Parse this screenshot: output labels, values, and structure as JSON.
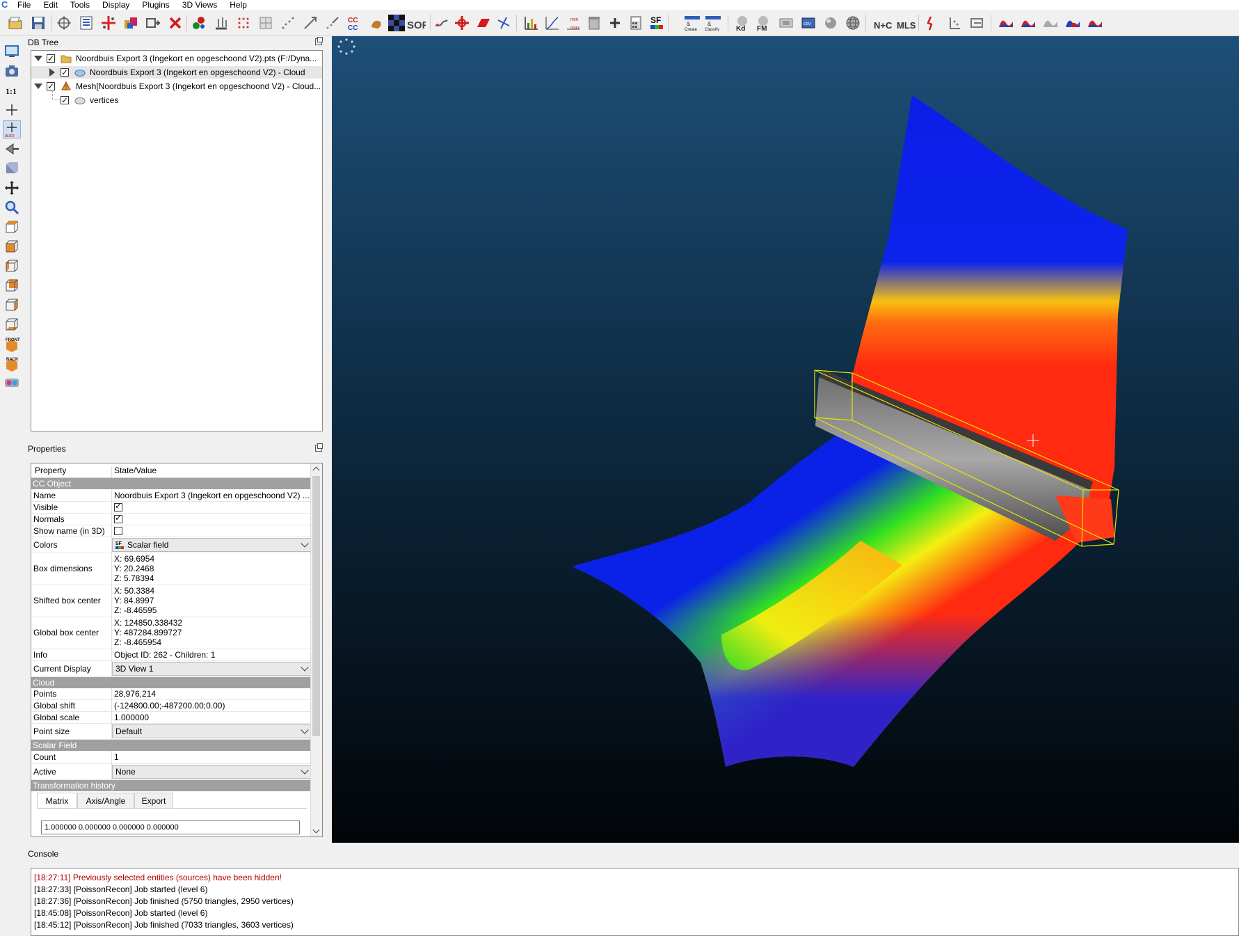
{
  "app": {
    "icon": "cloudcompare-logo-icon"
  },
  "menu": [
    "File",
    "Edit",
    "Tools",
    "Display",
    "Plugins",
    "3D Views",
    "Help"
  ],
  "toolbar": {
    "icons": [
      "open-icon",
      "save-icon",
      "global-shift-icon",
      "list-icon",
      "add-point-icon",
      "merge-icon",
      "clone-icon",
      "delete-icon",
      "sample-icon",
      "normals-icon",
      "subsample-icon",
      "octree-icon",
      "sf-gradient-icon",
      "register-icon",
      "align-icon",
      "cloud-cloud-dist-icon",
      "cloud-mesh-dist-icon",
      "checkerboard-icon",
      "sor-icon",
      "segment-icon",
      "translate-rotate-icon",
      "cross-section-icon",
      "point-pick-icon",
      "histogram-icon",
      "sf-gradient-plot-icon",
      "sf-minmax-icon",
      "filter-icon",
      "add-icon",
      "calculator-icon",
      "sf-icon",
      "canupo-create-icon",
      "canupo-classify-icon",
      "kd-icon",
      "fm-icon",
      "plane-fit-icon",
      "quadric-icon",
      "sphere-icon",
      "globe-icon",
      "n-c-icon",
      "mls-icon",
      "sf-tool-icon",
      "rasterize-icon",
      "clean-icon",
      "pcv-1-icon",
      "pcv-2-icon",
      "pcv-3-icon",
      "pcv-4-icon",
      "pcv-5-icon"
    ],
    "labels": {
      "sor": "SOR",
      "sf": "SF",
      "kd": "Kd",
      "fm": "FM",
      "nc": "N+C",
      "mls": "MLS",
      "cc": "CC\nCC",
      "canupo1": "CANUPO Create",
      "canupo2": "CANUPO Classify"
    }
  },
  "left_tools": [
    "display-icon",
    "camera-icon",
    "one-to-one-icon",
    "crosshair-icon",
    "auto-pick-icon",
    "perspective-icon",
    "cube-view-icon",
    "move-icon",
    "zoom-icon",
    "top-view-icon",
    "front-view-icon",
    "left-view-icon",
    "back-view-icon",
    "right-view-icon",
    "bottom-view-icon",
    "front-iso-icon",
    "back-iso-icon",
    "stereo-icon"
  ],
  "left_labels": {
    "one_to_one": "1:1",
    "auto": "auto",
    "front": "FRONT",
    "back": "BACK"
  },
  "db_tree": {
    "title": "DB Tree",
    "items": [
      {
        "label": "Noordbuis Export 3 (Ingekort en opgeschoond V2).pts (F:/Dyna...",
        "icon": "folder-icon",
        "checked": true
      },
      {
        "label": "Noordbuis Export 3 (Ingekort en opgeschoond V2) - Cloud",
        "icon": "cloud-icon",
        "checked": true
      },
      {
        "label": "Mesh[Noordbuis Export 3 (Ingekort en opgeschoond V2) - Cloud...",
        "icon": "mesh-icon",
        "checked": true
      },
      {
        "label": "vertices",
        "icon": "cloud-icon",
        "checked": true
      }
    ]
  },
  "properties": {
    "title": "Properties",
    "header": {
      "property": "Property",
      "value": "State/Value"
    },
    "sections": {
      "cc_object": "CC Object",
      "cloud": "Cloud",
      "scalar_field": "Scalar Field",
      "transformation_history": "Transformation history"
    },
    "rows": {
      "name": {
        "key": "Name",
        "value": "Noordbuis Export 3 (Ingekort en opgeschoond V2) ..."
      },
      "visible": {
        "key": "Visible",
        "checked": true
      },
      "normals": {
        "key": "Normals",
        "checked": true
      },
      "show_name": {
        "key": "Show name (in 3D)",
        "checked": false
      },
      "colors": {
        "key": "Colors",
        "value": "Scalar field",
        "icon": "sf-icon"
      },
      "box_dimensions": {
        "key": "Box dimensions",
        "x": "X: 69.6954",
        "y": "Y: 20.2468",
        "z": "Z: 5.78394"
      },
      "shifted_box_center": {
        "key": "Shifted box center",
        "x": "X: 50.3384",
        "y": "Y: 84.8997",
        "z": "Z: -8.46595"
      },
      "global_box_center": {
        "key": "Global box center",
        "x": "X: 124850.338432",
        "y": "Y: 487284.899727",
        "z": "Z: -8.465954"
      },
      "info": {
        "key": "Info",
        "value": "Object ID: 262 - Children: 1"
      },
      "current_display": {
        "key": "Current Display",
        "value": "3D View 1"
      },
      "points": {
        "key": "Points",
        "value": "28,976,214"
      },
      "global_shift": {
        "key": "Global shift",
        "value": "(-124800.00;-487200.00;0.00)"
      },
      "global_scale": {
        "key": "Global scale",
        "value": "1.000000"
      },
      "point_size": {
        "key": "Point size",
        "value": "Default"
      },
      "count": {
        "key": "Count",
        "value": "1"
      },
      "active": {
        "key": "Active",
        "value": "None"
      }
    },
    "tabs": [
      "Matrix",
      "Axis/Angle",
      "Export"
    ],
    "matrix_line": "1.000000 0.000000 0.000000 0.000000"
  },
  "console": {
    "title": "Console",
    "lines": [
      {
        "text": "[18:27:11] Previously selected entities (sources) have been hidden!",
        "color": "#b00000"
      },
      {
        "text": "[18:27:33] [PoissonRecon] Job started (level 6)",
        "color": "#000000"
      },
      {
        "text": "[18:27:36] [PoissonRecon] Job finished (5750 triangles, 2950 vertices)",
        "color": "#000000"
      },
      {
        "text": "[18:45:08] [PoissonRecon] Job started (level 6)",
        "color": "#000000"
      },
      {
        "text": "[18:45:12] [PoissonRecon] Job finished (7033 triangles, 3603 vertices)",
        "color": "#000000"
      }
    ]
  },
  "view3d": {
    "background_top": "#1d4f78",
    "background_bottom": "#020508",
    "colors": {
      "blue": "#0a22e8",
      "red": "#ff2a10",
      "yellow": "#f4ef10",
      "green": "#30e020",
      "bbox": "#e6e600"
    }
  }
}
